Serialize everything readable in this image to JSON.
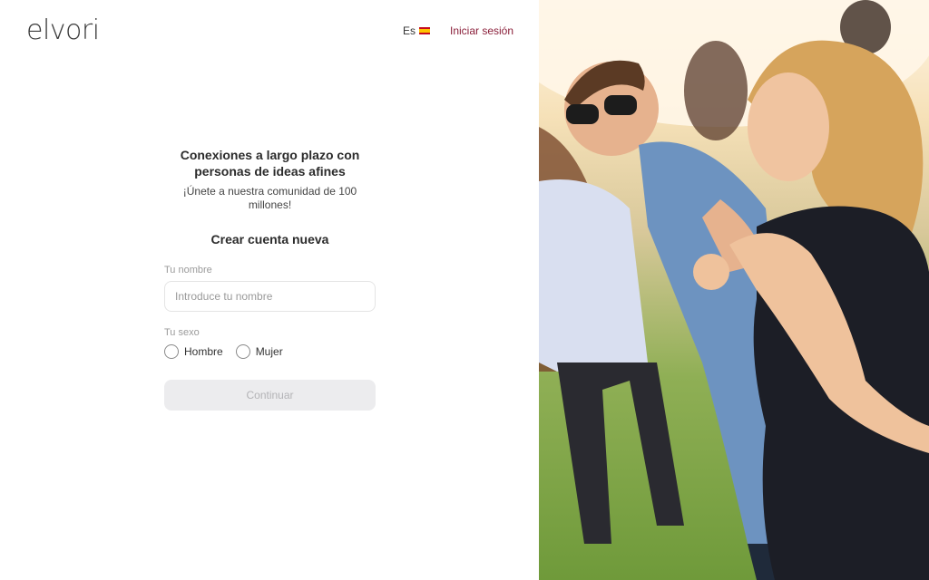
{
  "header": {
    "logo": "elvori",
    "language": "Es",
    "login_link": "Iniciar sesión"
  },
  "main": {
    "headline": "Conexiones a largo plazo con personas de ideas afines",
    "subheadline": "¡Únete a nuestra comunidad de 100 millones!",
    "form_title": "Crear cuenta nueva",
    "name_label": "Tu nombre",
    "name_placeholder": "Introduce tu nombre",
    "name_value": "",
    "sex_label": "Tu sexo",
    "sex_options": [
      "Hombre",
      "Mujer"
    ],
    "continue_label": "Continuar"
  },
  "photo": {
    "icon": "people-outdoors-photo"
  },
  "colors": {
    "login_link": "#8a1f3a",
    "button_disabled_bg": "#ececee",
    "button_disabled_text": "#b3b3b6"
  }
}
